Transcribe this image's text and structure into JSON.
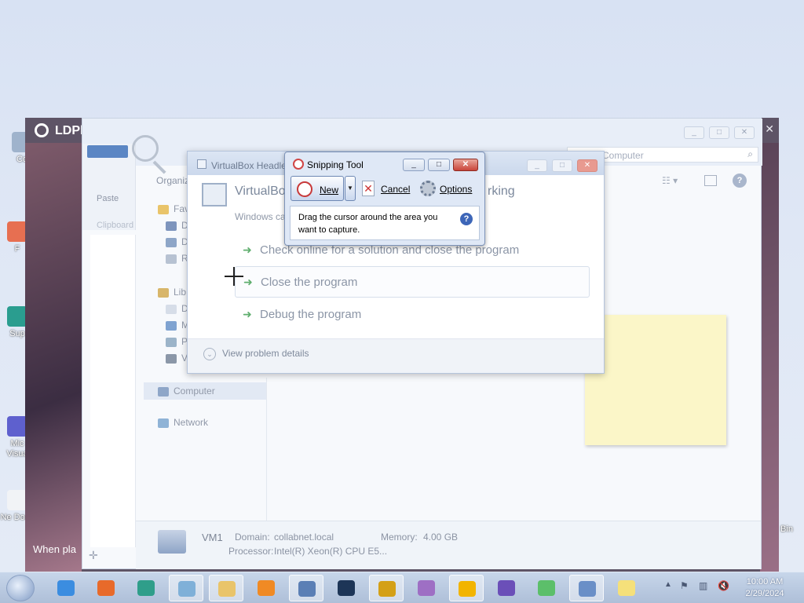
{
  "desktop": {
    "icons": [
      {
        "label": "Co"
      },
      {
        "label": "F"
      },
      {
        "label": "Sup"
      },
      {
        "label": "Mic Visua"
      },
      {
        "label": "Ne Docu"
      }
    ],
    "right_label": "Bin"
  },
  "ldplayer": {
    "title": "LDPl",
    "close_glyph": "✕",
    "status": "When pla"
  },
  "explorer": {
    "search_placeholder": "Computer",
    "organize_label": "Organiz",
    "paste_label": "Paste",
    "clipboard_label": "Clipboard",
    "nav": {
      "favorites": "Fav",
      "fav_items": [
        "D",
        "D",
        "R"
      ],
      "libraries": "Lib",
      "lib_items": [
        "D",
        "M",
        "P",
        "V"
      ],
      "computer": "Computer",
      "network": "Network"
    },
    "details": {
      "name": "VM1",
      "domain_label": "Domain:",
      "domain": "collabnet.local",
      "memory_label": "Memory:",
      "memory": "4.00 GB",
      "processor_label": "Processor:",
      "processor": "Intel(R) Xeon(R) CPU E5..."
    }
  },
  "error_dialog": {
    "title": "VirtualBox Headle",
    "heading": "VirtualBo",
    "heading_tail": "rking",
    "subtitle": "Windows ca",
    "options": [
      "Check online for a solution and close the program",
      "Close the program",
      "Debug the program"
    ],
    "details_label": "View problem details"
  },
  "snipping_tool": {
    "title": "Snipping Tool",
    "new_label": "New",
    "cancel_label": "Cancel",
    "options_label": "Options",
    "message": "Drag the cursor around the area you want to capture.",
    "help_glyph": "?"
  },
  "taskbar": {
    "time": "10:00 AM",
    "date": "2/29/2024",
    "apps": [
      {
        "name": "internet-explorer",
        "color": "#3b8de0"
      },
      {
        "name": "firefox",
        "color": "#e86a2a"
      },
      {
        "name": "app-3",
        "color": "#2f9e8a"
      },
      {
        "name": "app-4",
        "color": "#7fb0d8"
      },
      {
        "name": "file-explorer",
        "color": "#e9c46a"
      },
      {
        "name": "media-player",
        "color": "#f08a24"
      },
      {
        "name": "remote-desktop",
        "color": "#5b7fb5"
      },
      {
        "name": "steam",
        "color": "#1d3557"
      },
      {
        "name": "app-9",
        "color": "#d4a017"
      },
      {
        "name": "paint",
        "color": "#9e6fc4"
      },
      {
        "name": "ldplayer",
        "color": "#f2b400"
      },
      {
        "name": "app-12",
        "color": "#6b4fb8"
      },
      {
        "name": "photos",
        "color": "#5cbf6a"
      },
      {
        "name": "snipping-tool",
        "color": "#6a8fc7"
      },
      {
        "name": "sticky-notes",
        "color": "#f5e07a"
      }
    ]
  },
  "colors": {
    "accent": "#3d66b8",
    "close_red": "#c9443a",
    "sticky": "#fbf6c8",
    "option_arrow": "#5fae6e"
  }
}
